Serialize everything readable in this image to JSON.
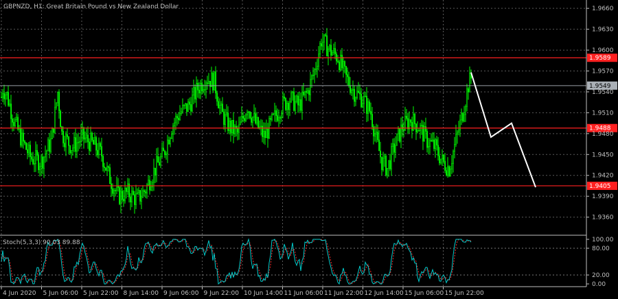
{
  "chart_data": {
    "type": "candlestick",
    "title": "GBPNZD, H1:  Great Britain Pound vs New Zealand Dollar",
    "price_axis": {
      "ylim": [
        1.9335,
        1.9672
      ],
      "ticks": [
        "1.9660",
        "1.9630",
        "1.9600",
        "1.9570",
        "1.9540",
        "1.9510",
        "1.9480",
        "1.9450",
        "1.9420",
        "1.9390",
        "1.9360"
      ]
    },
    "horizontal_levels": [
      {
        "price": 1.9589,
        "label": "1.9589",
        "color": "#ff2020"
      },
      {
        "price": 1.9488,
        "label": "1.9488",
        "color": "#ff2020"
      },
      {
        "price": 1.9405,
        "label": "1.9405",
        "color": "#ff2020"
      }
    ],
    "current_price": {
      "price": 1.9549,
      "label": "1.9549",
      "color": "#9aa0a6"
    },
    "candle_color": "#00ff00",
    "price_anchors": [
      [
        0,
        1.952
      ],
      [
        4,
        1.9545
      ],
      [
        10,
        1.9535
      ],
      [
        20,
        1.95
      ],
      [
        32,
        1.947
      ],
      [
        45,
        1.9445
      ],
      [
        60,
        1.944
      ],
      [
        75,
        1.947
      ],
      [
        84,
        1.954
      ],
      [
        90,
        1.948
      ],
      [
        105,
        1.946
      ],
      [
        120,
        1.9475
      ],
      [
        135,
        1.9465
      ],
      [
        148,
        1.945
      ],
      [
        158,
        1.942
      ],
      [
        172,
        1.939
      ],
      [
        186,
        1.9395
      ],
      [
        200,
        1.9385
      ],
      [
        212,
        1.94
      ],
      [
        226,
        1.943
      ],
      [
        238,
        1.945
      ],
      [
        250,
        1.949
      ],
      [
        262,
        1.951
      ],
      [
        275,
        1.952
      ],
      [
        288,
        1.9545
      ],
      [
        300,
        1.956
      ],
      [
        312,
        1.9555
      ],
      [
        322,
        1.951
      ],
      [
        334,
        1.949
      ],
      [
        346,
        1.948
      ],
      [
        360,
        1.952
      ],
      [
        372,
        1.9495
      ],
      [
        385,
        1.9475
      ],
      [
        398,
        1.95
      ],
      [
        410,
        1.952
      ],
      [
        422,
        1.953
      ],
      [
        435,
        1.952
      ],
      [
        448,
        1.954
      ],
      [
        458,
        1.957
      ],
      [
        468,
        1.9615
      ],
      [
        480,
        1.96
      ],
      [
        492,
        1.959
      ],
      [
        504,
        1.956
      ],
      [
        516,
        1.954
      ],
      [
        528,
        1.953
      ],
      [
        540,
        1.951
      ],
      [
        548,
        1.947
      ],
      [
        556,
        1.944
      ],
      [
        564,
        1.943
      ],
      [
        574,
        1.946
      ],
      [
        586,
        1.949
      ],
      [
        598,
        1.95
      ],
      [
        610,
        1.949
      ],
      [
        622,
        1.947
      ],
      [
        634,
        1.946
      ],
      [
        644,
        1.944
      ],
      [
        654,
        1.943
      ],
      [
        664,
        1.947
      ],
      [
        674,
        1.951
      ],
      [
        682,
        1.955
      ],
      [
        686,
        1.956
      ]
    ],
    "projection_path": [
      [
        686,
        1.9568
      ],
      [
        715,
        1.9475
      ],
      [
        745,
        1.9495
      ],
      [
        780,
        1.9403
      ]
    ],
    "projection_color": "#ffffff",
    "oscillator": {
      "label": "Stoch(5,3,3) 90.03 89.88",
      "ylim": [
        0,
        100
      ],
      "ticks": [
        "100.00",
        "80.00",
        "20.00",
        "0.00"
      ],
      "levels": [
        80,
        20
      ],
      "main_color": "#00cccc",
      "signal_color": "#ff3030"
    },
    "time_axis": {
      "labels": [
        "4 Jun 2020",
        "5 Jun 06:00",
        "5 Jun 22:00",
        "8 Jun 14:00",
        "9 Jun 06:00",
        "9 Jun 22:00",
        "10 Jun 14:00",
        "11 Jun 06:00",
        "11 Jun 22:00",
        "12 Jun 14:00",
        "15 Jun 06:00",
        "15 Jun 22:00"
      ]
    }
  }
}
